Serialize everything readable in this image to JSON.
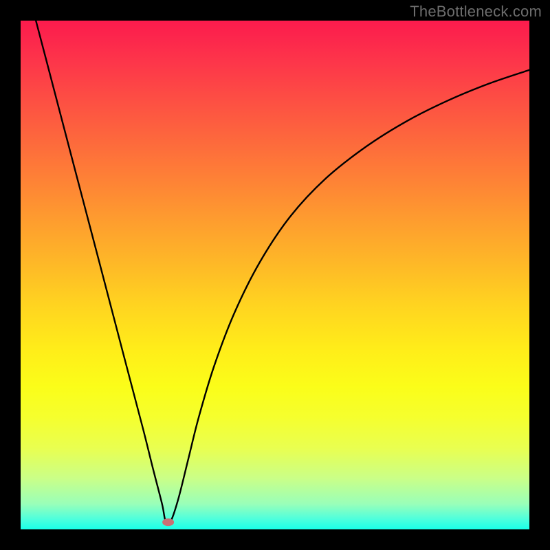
{
  "watermark": "TheBottleneck.com",
  "colors": {
    "background": "#000000",
    "gradient_top": "#fc1b4d",
    "gradient_bottom": "#19ffe9",
    "curve": "#000000",
    "marker_fill": "#c96f74",
    "marker_stroke": "#c96f74"
  },
  "chart_data": {
    "type": "line",
    "title": "",
    "xlabel": "",
    "ylabel": "",
    "x_range": [
      0,
      100
    ],
    "y_range": [
      0,
      100
    ],
    "curve": {
      "x": [
        3,
        5,
        10,
        15,
        20,
        24,
        26,
        27.8,
        28.5,
        29.5,
        31,
        33,
        35,
        38,
        42,
        47,
        53,
        60,
        68,
        76,
        84,
        92,
        100
      ],
      "y": [
        100,
        92.4,
        73.3,
        54.3,
        35.2,
        20,
        12,
        5,
        1.6,
        1.6,
        6,
        14,
        22,
        32,
        42.5,
        52.5,
        61.5,
        69,
        75.3,
        80.3,
        84.3,
        87.6,
        90.3
      ]
    },
    "marker": {
      "x": 29.0,
      "y": 1.4
    },
    "annotations": []
  }
}
